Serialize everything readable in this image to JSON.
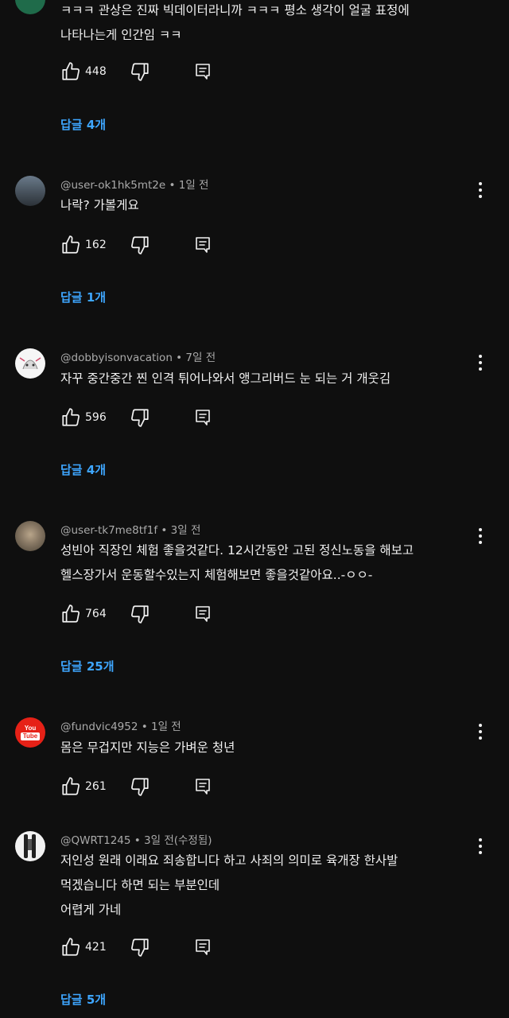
{
  "colors": {
    "background": "#0f0f0f",
    "text": "#f1f1f1",
    "meta": "#aaaaaa",
    "reply_link": "#3ea6ff",
    "youtube_red": "#e62117"
  },
  "comments": [
    {
      "author": "",
      "time": "",
      "lines": [
        "ㅋㅋㅋ 관상은 진짜 빅데이터라니까 ㅋㅋㅋ 평소 생각이 얼굴 표정에",
        "나타나는게 인간임 ㅋㅋ"
      ],
      "likes": "448",
      "replies": "답글 4개"
    },
    {
      "author": "@user-ok1hk5mt2e",
      "time": " • 1일 전",
      "lines": [
        "나락? 가볼게요"
      ],
      "likes": "162",
      "replies": "답글 1개"
    },
    {
      "author": "@dobbyisonvacation",
      "time": " • 7일 전",
      "lines": [
        "자꾸 중간중간 찐 인격 튀어나와서 앵그리버드 눈 되는 거 개웃김"
      ],
      "likes": "596",
      "replies": "답글 4개"
    },
    {
      "author": "@user-tk7me8tf1f",
      "time": " • 3일 전",
      "lines": [
        "성빈아 직장인 체험 좋을것같다. 12시간동안 고된 정신노동을 해보고",
        "헬스장가서 운동할수있는지 체험해보면 좋을것같아요..-ㅇㅇ-"
      ],
      "likes": "764",
      "replies": "답글 25개"
    },
    {
      "author": "@fundvic4952",
      "time": " • 1일 전",
      "lines": [
        "몸은 무겁지만 지능은 가벼운 청년"
      ],
      "likes": "261",
      "replies": ""
    },
    {
      "author": "@QWRT1245",
      "time": " • 3일 전(수정됨)",
      "lines": [
        "저인성 원래 이래요  죄송합니다  하고 사죄의 의미로  육개장 한사발",
        "먹겠습니다 하면 되는 부분인데",
        "어렵게 가네"
      ],
      "likes": "421",
      "replies": "답글 5개"
    }
  ],
  "icons": {
    "like": "thumbs-up-icon",
    "dislike": "thumbs-down-icon",
    "reply": "comment-reply-icon",
    "more": "more-vert-icon",
    "youtube_avatar_text": "You Tube"
  }
}
